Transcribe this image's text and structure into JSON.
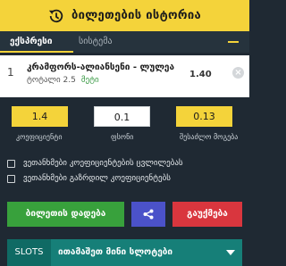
{
  "header": {
    "title": "ბილეთების ისტორია"
  },
  "tabs": [
    {
      "label": "ექსპრესი",
      "active": true
    },
    {
      "label": "სისტემა",
      "active": false
    }
  ],
  "bet": {
    "number": "1",
    "match": "კრამფორს-ალიანსენი - ლულეა",
    "market": "ტოტალი 2.5",
    "pick": "მეტი",
    "odd": "1.40",
    "close": "×"
  },
  "inputs": {
    "coef_value": "1.4",
    "stake_value": "0.1",
    "win_value": "0.13",
    "coef_label": "კოეფიციენტი",
    "stake_label": "ფსონი",
    "win_label": "შესაძლო მოგება"
  },
  "options": [
    "ვეთანხმები კოეფიციენტების ცვლილებას",
    "ვეთანხმები გაზრდილ კოეფიციენტებს"
  ],
  "buttons": {
    "place": "ბილეთის დადება",
    "cancel": "გაუქმება"
  },
  "slots": {
    "label": "SLOTS",
    "text": "ითამაშეთ მინი სლოტები"
  },
  "colors": {
    "accent": "#f4d33a",
    "background": "#1f2933",
    "place_button": "#38a13c",
    "share_button": "#4b52c9",
    "cancel_button": "#d9363e",
    "slots_bar": "#167f78"
  }
}
